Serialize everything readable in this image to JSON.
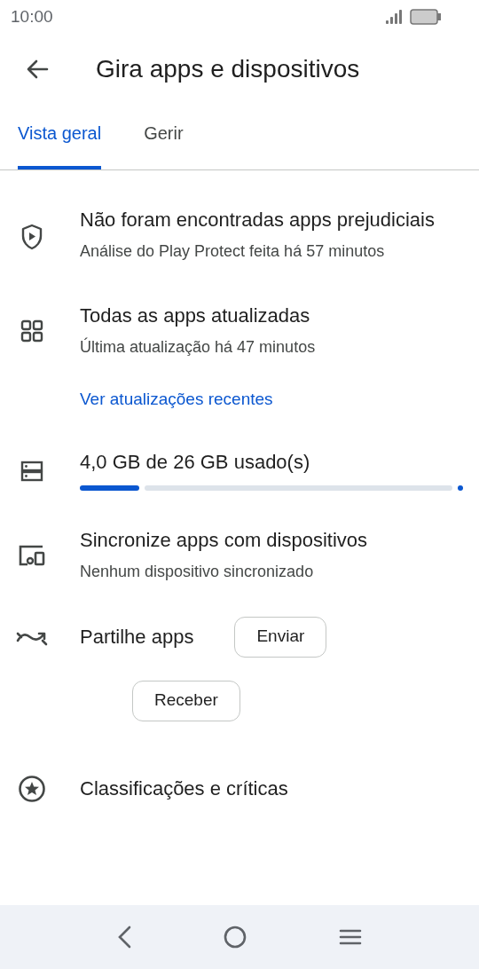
{
  "status_bar": {
    "time": "10:00"
  },
  "header": {
    "title": "Gira apps e dispositivos"
  },
  "tabs": [
    {
      "label": "Vista geral",
      "selected": true
    },
    {
      "label": "Gerir",
      "selected": false
    }
  ],
  "items": [
    {
      "kind": "protect",
      "title": "Não foram encontradas apps prejudiciais",
      "subtitle": "Análise do Play Protect feita há 57 minutos"
    },
    {
      "kind": "updates",
      "title": "Todas as apps atualizadas",
      "subtitle": "Última atualização há 47 minutos",
      "link": "Ver atualizações recentes"
    },
    {
      "kind": "storage",
      "title": "4,0 GB de 26 GB usado(s)",
      "level": 0.154
    },
    {
      "kind": "sync",
      "title": "Sincronize apps com dispositivos",
      "subtitle": "Nenhum dispositivo sincronizado"
    },
    {
      "kind": "share",
      "title": "Partilhe apps",
      "buttons": [
        "Enviar",
        "Receber"
      ]
    },
    {
      "kind": "ratings",
      "title": "Classificações e críticas"
    }
  ]
}
